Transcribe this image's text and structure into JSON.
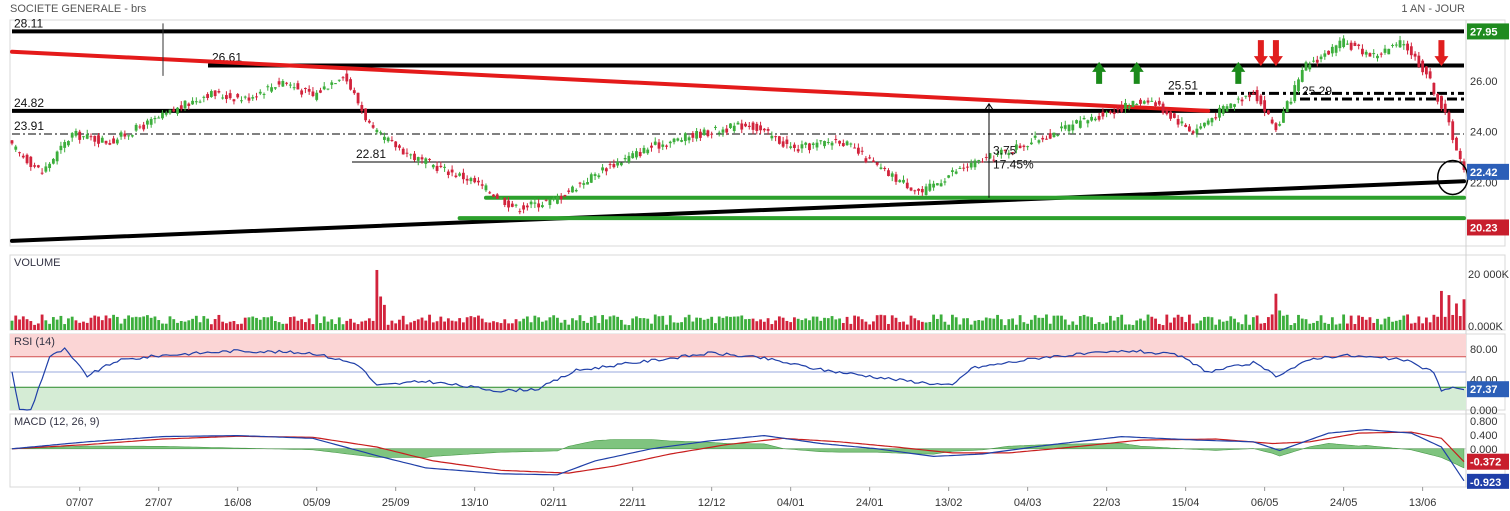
{
  "header": {
    "title": "SOCIETE GENERALE - brs",
    "period": "1 AN - JOUR"
  },
  "chart_data": [
    {
      "type": "candlestick",
      "panel": "price",
      "ylim": [
        19.5,
        28.4
      ],
      "y_ticks": [
        "26.00",
        "24.00",
        "22.00"
      ],
      "x_ticks": [
        "07/07",
        "27/07",
        "16/08",
        "05/09",
        "25/09",
        "13/10",
        "02/11",
        "22/11",
        "12/12",
        "04/01",
        "24/01",
        "13/02",
        "04/03",
        "22/03",
        "15/04",
        "06/05",
        "24/05",
        "13/06"
      ],
      "close_anchors": [
        {
          "i": 0,
          "v": 23.4
        },
        {
          "i": 8,
          "v": 22.4
        },
        {
          "i": 16,
          "v": 23.9
        },
        {
          "i": 26,
          "v": 23.6
        },
        {
          "i": 40,
          "v": 24.6
        },
        {
          "i": 52,
          "v": 25.5
        },
        {
          "i": 62,
          "v": 25.3
        },
        {
          "i": 72,
          "v": 26.0
        },
        {
          "i": 80,
          "v": 25.4
        },
        {
          "i": 88,
          "v": 26.3
        },
        {
          "i": 96,
          "v": 24.0
        },
        {
          "i": 108,
          "v": 22.9
        },
        {
          "i": 122,
          "v": 22.1
        },
        {
          "i": 134,
          "v": 21.0
        },
        {
          "i": 144,
          "v": 21.3
        },
        {
          "i": 158,
          "v": 22.6
        },
        {
          "i": 170,
          "v": 23.4
        },
        {
          "i": 182,
          "v": 23.9
        },
        {
          "i": 196,
          "v": 24.3
        },
        {
          "i": 208,
          "v": 23.3
        },
        {
          "i": 220,
          "v": 23.7
        },
        {
          "i": 232,
          "v": 22.4
        },
        {
          "i": 242,
          "v": 21.6
        },
        {
          "i": 250,
          "v": 22.4
        },
        {
          "i": 262,
          "v": 23.1
        },
        {
          "i": 276,
          "v": 23.9
        },
        {
          "i": 290,
          "v": 24.7
        },
        {
          "i": 302,
          "v": 25.3
        },
        {
          "i": 314,
          "v": 24.0
        },
        {
          "i": 322,
          "v": 24.9
        },
        {
          "i": 330,
          "v": 25.6
        },
        {
          "i": 336,
          "v": 24.1
        },
        {
          "i": 344,
          "v": 26.6
        },
        {
          "i": 354,
          "v": 27.5
        },
        {
          "i": 362,
          "v": 27.0
        },
        {
          "i": 370,
          "v": 27.5
        },
        {
          "i": 376,
          "v": 26.3
        },
        {
          "i": 382,
          "v": 24.3
        },
        {
          "i": 386,
          "v": 22.4
        }
      ],
      "levels": [
        {
          "label": "28.11",
          "value": 27.95,
          "style": "solid"
        },
        {
          "label": "26.61",
          "value": 26.61,
          "style": "solid"
        },
        {
          "label": "25.51",
          "value": 25.51,
          "style": "dashdot"
        },
        {
          "label": "25.29",
          "value": 25.29,
          "style": "dashdot"
        },
        {
          "label": "24.82",
          "value": 24.82,
          "style": "solid"
        },
        {
          "label": "23.91",
          "value": 23.91,
          "style": "dashdot-thin"
        },
        {
          "label": "22.81",
          "value": 22.81,
          "style": "thin"
        }
      ],
      "annotations": [
        {
          "text": "3.75"
        },
        {
          "text": "17.45%"
        }
      ],
      "trendlines": [
        {
          "name": "resistance",
          "color": "#e41a1a",
          "from": {
            "i": 0,
            "v": 27.15
          },
          "to": {
            "i": 318,
            "v": 24.82
          }
        },
        {
          "name": "support",
          "color": "#000000",
          "from": {
            "i": 0,
            "v": 19.7
          },
          "to": {
            "i": 386,
            "v": 22.05
          }
        },
        {
          "name": "green-upper",
          "color": "#2ca02c",
          "from": {
            "i": 126,
            "v": 21.4
          },
          "to": {
            "i": 386,
            "v": 21.4
          }
        },
        {
          "name": "green-lower",
          "color": "#2ca02c",
          "from": {
            "i": 126,
            "v": 20.6
          },
          "to": {
            "i": 386,
            "v": 20.6
          }
        }
      ],
      "signals_buy_x": [
        289,
        299,
        326
      ],
      "signals_sell_x": [
        332,
        336,
        380
      ],
      "badges": [
        {
          "label": "27.95",
          "value": 27.95,
          "color": "#1f8b1f"
        },
        {
          "label": "22.42",
          "value": 22.42,
          "color": "#2c5fb8"
        },
        {
          "label": "20.23",
          "value": 20.23,
          "color": "#c81e2d"
        }
      ]
    },
    {
      "type": "bar",
      "panel": "volume",
      "title": "VOLUME",
      "y_ticks": [
        "20 000K",
        "0.000K"
      ],
      "ylim": [
        0,
        24000
      ],
      "spikes": [
        {
          "i": 97,
          "v": 21500
        },
        {
          "i": 98,
          "v": 12000
        },
        {
          "i": 99,
          "v": 9000
        },
        {
          "i": 336,
          "v": 13000
        },
        {
          "i": 337,
          "v": 7000
        },
        {
          "i": 380,
          "v": 14000
        },
        {
          "i": 382,
          "v": 12500
        },
        {
          "i": 384,
          "v": 9500
        },
        {
          "i": 386,
          "v": 11000
        }
      ],
      "base": 3500
    },
    {
      "type": "line",
      "panel": "rsi",
      "title": "RSI (14)",
      "y_ticks": [
        "80.00",
        "40.00",
        "0.000"
      ],
      "ylim": [
        0,
        100
      ],
      "zones": {
        "overbought": 70,
        "oversold": 30,
        "mid": 50
      },
      "current_label": "27.37",
      "anchors": [
        {
          "i": 0,
          "v": 50
        },
        {
          "i": 2,
          "v": 0
        },
        {
          "i": 5,
          "v": 0
        },
        {
          "i": 10,
          "v": 70
        },
        {
          "i": 14,
          "v": 80
        },
        {
          "i": 20,
          "v": 45
        },
        {
          "i": 28,
          "v": 65
        },
        {
          "i": 40,
          "v": 72
        },
        {
          "i": 60,
          "v": 78
        },
        {
          "i": 80,
          "v": 75
        },
        {
          "i": 92,
          "v": 60
        },
        {
          "i": 97,
          "v": 32
        },
        {
          "i": 110,
          "v": 38
        },
        {
          "i": 130,
          "v": 25
        },
        {
          "i": 140,
          "v": 28
        },
        {
          "i": 150,
          "v": 52
        },
        {
          "i": 165,
          "v": 62
        },
        {
          "i": 186,
          "v": 75
        },
        {
          "i": 200,
          "v": 68
        },
        {
          "i": 215,
          "v": 53
        },
        {
          "i": 235,
          "v": 40
        },
        {
          "i": 250,
          "v": 32
        },
        {
          "i": 255,
          "v": 55
        },
        {
          "i": 275,
          "v": 70
        },
        {
          "i": 298,
          "v": 78
        },
        {
          "i": 310,
          "v": 72
        },
        {
          "i": 318,
          "v": 50
        },
        {
          "i": 330,
          "v": 62
        },
        {
          "i": 336,
          "v": 45
        },
        {
          "i": 346,
          "v": 68
        },
        {
          "i": 354,
          "v": 72
        },
        {
          "i": 370,
          "v": 66
        },
        {
          "i": 378,
          "v": 50
        },
        {
          "i": 380,
          "v": 25
        },
        {
          "i": 384,
          "v": 30
        },
        {
          "i": 386,
          "v": 27.37
        }
      ]
    },
    {
      "type": "line",
      "panel": "macd",
      "title": "MACD (12, 26, 9)",
      "y_ticks": [
        "0.800",
        "0.400",
        "0.000"
      ],
      "ylim": [
        -1.1,
        1.0
      ],
      "current_signal_label": "-0.372",
      "current_macd_label": "-0.923",
      "macd_anchors": [
        {
          "i": 0,
          "v": 0.0
        },
        {
          "i": 20,
          "v": 0.2
        },
        {
          "i": 40,
          "v": 0.35
        },
        {
          "i": 60,
          "v": 0.38
        },
        {
          "i": 80,
          "v": 0.3
        },
        {
          "i": 97,
          "v": -0.2
        },
        {
          "i": 110,
          "v": -0.55
        },
        {
          "i": 130,
          "v": -0.72
        },
        {
          "i": 145,
          "v": -0.75
        },
        {
          "i": 155,
          "v": -0.35
        },
        {
          "i": 170,
          "v": 0.0
        },
        {
          "i": 185,
          "v": 0.22
        },
        {
          "i": 200,
          "v": 0.38
        },
        {
          "i": 215,
          "v": 0.15
        },
        {
          "i": 230,
          "v": 0.0
        },
        {
          "i": 245,
          "v": -0.22
        },
        {
          "i": 258,
          "v": -0.15
        },
        {
          "i": 275,
          "v": 0.1
        },
        {
          "i": 295,
          "v": 0.35
        },
        {
          "i": 315,
          "v": 0.25
        },
        {
          "i": 330,
          "v": 0.2
        },
        {
          "i": 337,
          "v": -0.05
        },
        {
          "i": 350,
          "v": 0.45
        },
        {
          "i": 360,
          "v": 0.55
        },
        {
          "i": 372,
          "v": 0.45
        },
        {
          "i": 380,
          "v": 0.05
        },
        {
          "i": 386,
          "v": -0.923
        }
      ],
      "signal_anchors": [
        {
          "i": 0,
          "v": 0.0
        },
        {
          "i": 20,
          "v": 0.12
        },
        {
          "i": 40,
          "v": 0.28
        },
        {
          "i": 60,
          "v": 0.36
        },
        {
          "i": 80,
          "v": 0.33
        },
        {
          "i": 97,
          "v": 0.05
        },
        {
          "i": 112,
          "v": -0.35
        },
        {
          "i": 130,
          "v": -0.62
        },
        {
          "i": 148,
          "v": -0.7
        },
        {
          "i": 160,
          "v": -0.5
        },
        {
          "i": 175,
          "v": -0.15
        },
        {
          "i": 190,
          "v": 0.12
        },
        {
          "i": 205,
          "v": 0.3
        },
        {
          "i": 220,
          "v": 0.2
        },
        {
          "i": 235,
          "v": 0.05
        },
        {
          "i": 250,
          "v": -0.12
        },
        {
          "i": 265,
          "v": -0.12
        },
        {
          "i": 282,
          "v": 0.05
        },
        {
          "i": 300,
          "v": 0.25
        },
        {
          "i": 320,
          "v": 0.28
        },
        {
          "i": 335,
          "v": 0.15
        },
        {
          "i": 345,
          "v": 0.2
        },
        {
          "i": 358,
          "v": 0.45
        },
        {
          "i": 372,
          "v": 0.48
        },
        {
          "i": 380,
          "v": 0.3
        },
        {
          "i": 386,
          "v": -0.372
        }
      ]
    }
  ]
}
